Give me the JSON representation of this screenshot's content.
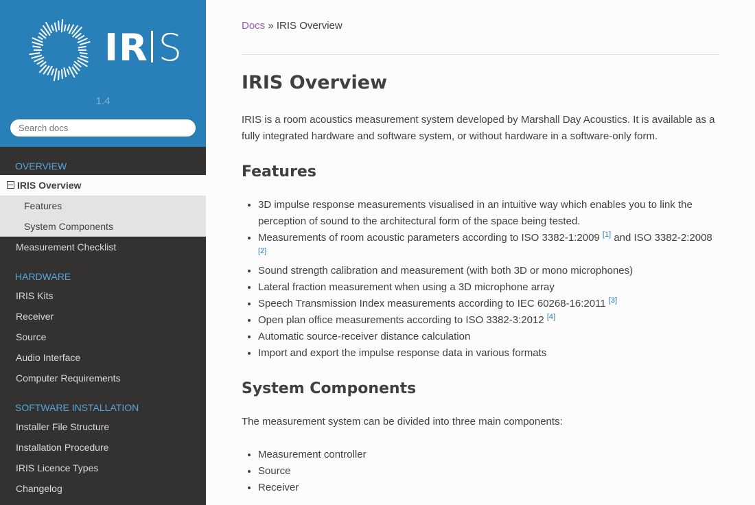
{
  "sidebar": {
    "logo_text": "IRIS",
    "version": "1.4",
    "search_placeholder": "Search docs",
    "sections": [
      {
        "caption": "OVERVIEW"
      },
      {
        "caption": "HARDWARE"
      },
      {
        "caption": "SOFTWARE INSTALLATION"
      }
    ],
    "items": {
      "iris_overview": "IRIS Overview",
      "features": "Features",
      "system_components": "System Components",
      "measurement_checklist": "Measurement Checklist",
      "iris_kits": "IRIS Kits",
      "receiver": "Receiver",
      "source": "Source",
      "audio_interface": "Audio Interface",
      "computer_requirements": "Computer Requirements",
      "installer_file_structure": "Installer File Structure",
      "installation_procedure": "Installation Procedure",
      "iris_licence_types": "IRIS Licence Types",
      "changelog": "Changelog"
    }
  },
  "breadcrumb": {
    "root": "Docs",
    "separator": " » ",
    "current": "IRIS Overview"
  },
  "page": {
    "title": "IRIS Overview",
    "intro": "IRIS is a room acoustics measurement system developed by Marshall Day Acoustics. It is available as a fully integrated hardware and software system, or without hardware in a software-only form.",
    "features_heading": "Features",
    "features": [
      {
        "text": "3D impulse response measurements visualised in an intuitive way which enables you to link the perception of sound to the architectural form of the space being tested.",
        "ref": ""
      },
      {
        "text": "Measurements of room acoustic parameters according to ISO 3382-1:2009 ",
        "ref": "[1]",
        "after": " and ISO 3382-2:2008 ",
        "ref2": "[2]"
      },
      {
        "text": "Sound strength calibration and measurement (with both 3D or mono microphones)",
        "ref": ""
      },
      {
        "text": "Lateral fraction measurement when using a 3D microphone array",
        "ref": ""
      },
      {
        "text": "Speech Transmission Index measurements according to IEC 60268-16:2011 ",
        "ref": "[3]"
      },
      {
        "text": "Open plan office measurements according to ISO 3382-3:2012 ",
        "ref": "[4]"
      },
      {
        "text": "Automatic source-receiver distance calculation",
        "ref": ""
      },
      {
        "text": "Import and export the impulse response data in various formats",
        "ref": ""
      }
    ],
    "components_heading": "System Components",
    "components_intro": "The measurement system can be divided into three main components:",
    "components": [
      "Measurement controller",
      "Source",
      "Receiver"
    ]
  },
  "colors": {
    "sidebar_bg": "#343131",
    "header_bg": "#2980b9",
    "caption": "#55a5d9",
    "link_visited": "#9b59b6",
    "link": "#2980b9"
  }
}
